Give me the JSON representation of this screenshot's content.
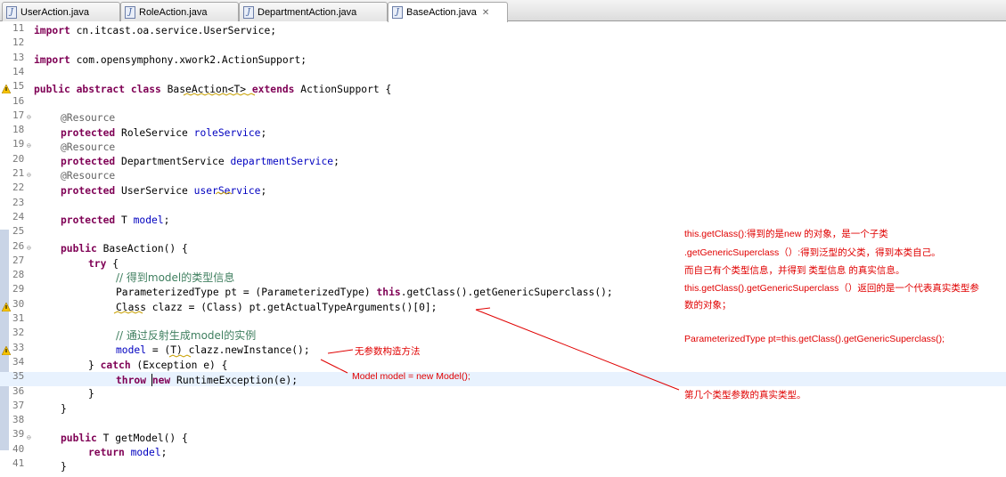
{
  "tabs": [
    {
      "label": "UserAction.java",
      "active": false
    },
    {
      "label": "RoleAction.java",
      "active": false
    },
    {
      "label": "DepartmentAction.java",
      "active": false
    },
    {
      "label": "BaseAction.java",
      "active": true
    }
  ],
  "line_numbers": [
    "11",
    "12",
    "13",
    "14",
    "15",
    "16",
    "17",
    "18",
    "19",
    "20",
    "21",
    "22",
    "23",
    "24",
    "25",
    "26",
    "27",
    "28",
    "29",
    "30",
    "31",
    "32",
    "33",
    "34",
    "35",
    "36",
    "37",
    "38",
    "39",
    "40",
    "41"
  ],
  "code": {
    "l11": {
      "kw": "import",
      "rest": " cn.itcast.oa.service.UserService;"
    },
    "l13": {
      "kw": "import",
      "rest": " com.opensymphony.xwork2.ActionSupport;"
    },
    "l15": {
      "kw1": "public abstract class",
      "mid": " BaseAction<T> ",
      "kw2": "extends",
      "rest": " ActionSupport {"
    },
    "l17": {
      "ann": "@Resource"
    },
    "l18": {
      "kw": "protected",
      "type": " RoleService ",
      "field": "roleService",
      "end": ";"
    },
    "l19": {
      "ann": "@Resource"
    },
    "l20": {
      "kw": "protected",
      "type": " DepartmentService ",
      "field": "departmentService",
      "end": ";"
    },
    "l21": {
      "ann": "@Resource"
    },
    "l22": {
      "kw": "protected",
      "type": " UserService ",
      "field": "userService",
      "end": ";"
    },
    "l24": {
      "kw": "protected",
      "type": " T ",
      "field": "model",
      "end": ";"
    },
    "l26": {
      "kw": "public",
      "rest": " BaseAction() {"
    },
    "l27": {
      "kw": "try",
      "rest": " {"
    },
    "l28": {
      "comment": "// 得到model的类型信息"
    },
    "l29": {
      "pre": "ParameterizedType pt = (ParameterizedType) ",
      "kw": "this",
      "rest": ".getClass().getGenericSuperclass();"
    },
    "l30": {
      "text": "Class clazz = (Class) pt.getActualTypeArguments()[0];"
    },
    "l32": {
      "comment": "// 通过反射生成model的实例"
    },
    "l33": {
      "field": "model",
      "rest": " = (T) clazz.newInstance();"
    },
    "l34": {
      "pre": "} ",
      "kw": "catch",
      "rest": " (Exception e) {"
    },
    "l35": {
      "kw1": "throw",
      "mid": " ",
      "kw2": "new",
      "rest": " RuntimeException(e);"
    },
    "l36": {
      "text": "}"
    },
    "l37": {
      "text": "}"
    },
    "l39": {
      "kw": "public",
      "rest": " T getModel() {"
    },
    "l40": {
      "kw": "return",
      "mid": " ",
      "field": "model",
      "end": ";"
    },
    "l41": {
      "text": "}"
    }
  },
  "notes": {
    "n1": "this.getClass():得到的是new 的对象，是一个子类",
    "n2": ".getGenericSuperclass（）:得到泛型的父类，得到本类自己。",
    "n3": "而自己有个类型信息，并得到 类型信息 的真实信息。",
    "n4": "this.getClass().getGenericSuperclass（）返回的是一个代表真实类型参",
    "n5": "数的对象；",
    "n6": "ParameterizedType pt=this.getClass().getGenericSuperclass();",
    "n7": "第几个类型参数的真实类型。",
    "n8": "无参数构造方法",
    "n9": "Model model = new Model();"
  },
  "colors": {
    "keyword": "#7f0055",
    "field": "#0000c0",
    "comment": "#3f7f5f",
    "annotation": "#646464",
    "note": "#e00000",
    "current_line": "#e8f2fe"
  }
}
